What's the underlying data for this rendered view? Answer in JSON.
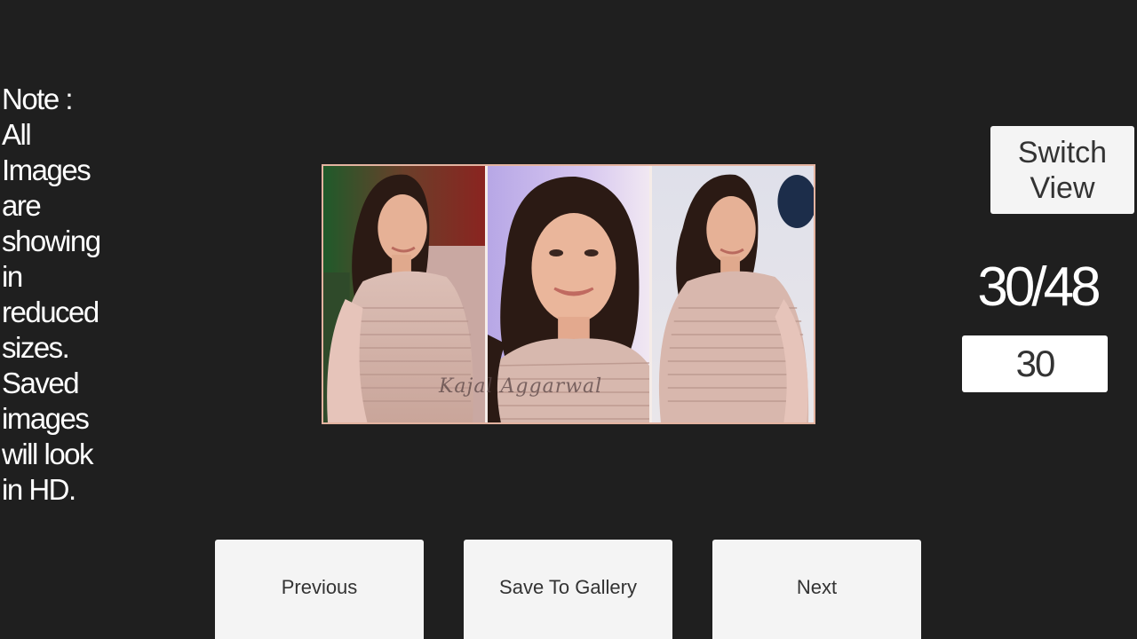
{
  "note": {
    "text": "Note :\nAll\nImages\nare\nshowing\nin\nreduced\nsizes.\nSaved\nimages\nwill look\nin HD."
  },
  "viewer": {
    "watermark": "Kajal Aggarwal",
    "colors": {
      "frame_border": "#e3b3a0",
      "dress": "#d8b7ad",
      "skin": "#e8b49a",
      "hair": "#2b1a14"
    }
  },
  "controls": {
    "switch_view_label": "Switch\nView",
    "counter": "30/48",
    "page_input_value": "30"
  },
  "nav": {
    "previous_label": "Previous",
    "save_label": "Save To Gallery",
    "next_label": "Next"
  },
  "colors": {
    "background": "#1f1f1f",
    "button_bg": "#f4f4f4",
    "button_text": "#333333",
    "text_light": "#ffffff"
  }
}
